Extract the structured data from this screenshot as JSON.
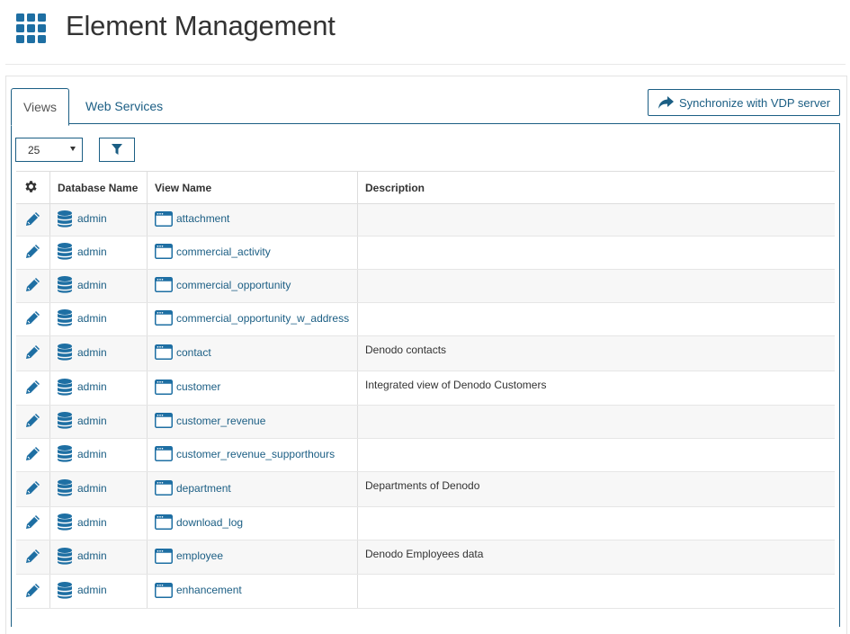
{
  "header": {
    "title": "Element Management"
  },
  "tabs": [
    {
      "label": "Views",
      "active": true
    },
    {
      "label": "Web Services",
      "active": false
    }
  ],
  "toolbar": {
    "sync_label": "Synchronize with VDP server",
    "page_size": "25"
  },
  "table": {
    "columns": [
      "",
      "Database Name",
      "View Name",
      "Description"
    ],
    "rows": [
      {
        "database": "admin",
        "view": "attachment",
        "description": ""
      },
      {
        "database": "admin",
        "view": "commercial_activity",
        "description": ""
      },
      {
        "database": "admin",
        "view": "commercial_opportunity",
        "description": ""
      },
      {
        "database": "admin",
        "view": "commercial_opportunity_w_address",
        "description": ""
      },
      {
        "database": "admin",
        "view": "contact",
        "description": "Denodo contacts"
      },
      {
        "database": "admin",
        "view": "customer",
        "description": "Integrated view of Denodo Customers"
      },
      {
        "database": "admin",
        "view": "customer_revenue",
        "description": ""
      },
      {
        "database": "admin",
        "view": "customer_revenue_supporthours",
        "description": ""
      },
      {
        "database": "admin",
        "view": "department",
        "description": "Departments of Denodo"
      },
      {
        "database": "admin",
        "view": "download_log",
        "description": ""
      },
      {
        "database": "admin",
        "view": "employee",
        "description": "Denodo Employees data"
      },
      {
        "database": "admin",
        "view": "enhancement",
        "description": ""
      }
    ]
  },
  "colors": {
    "accent": "#1b5e84",
    "icon_blue": "#1e6fa3"
  }
}
